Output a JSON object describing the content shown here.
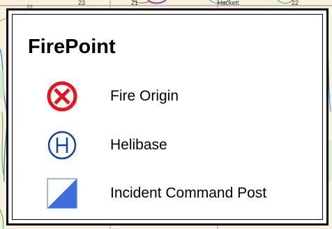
{
  "map": {
    "labels": [
      "23",
      "22",
      "21",
      "Hackett",
      "22"
    ]
  },
  "legend": {
    "title": "FirePoint",
    "items": [
      {
        "label": "Fire Origin",
        "icon": "fire-origin-icon",
        "color": "#e8141d"
      },
      {
        "label": "Helibase",
        "icon": "helibase-icon",
        "color": "#1340a8"
      },
      {
        "label": "Incident Command Post",
        "icon": "incident-command-post-icon",
        "color": "#3f6fdd"
      }
    ]
  }
}
